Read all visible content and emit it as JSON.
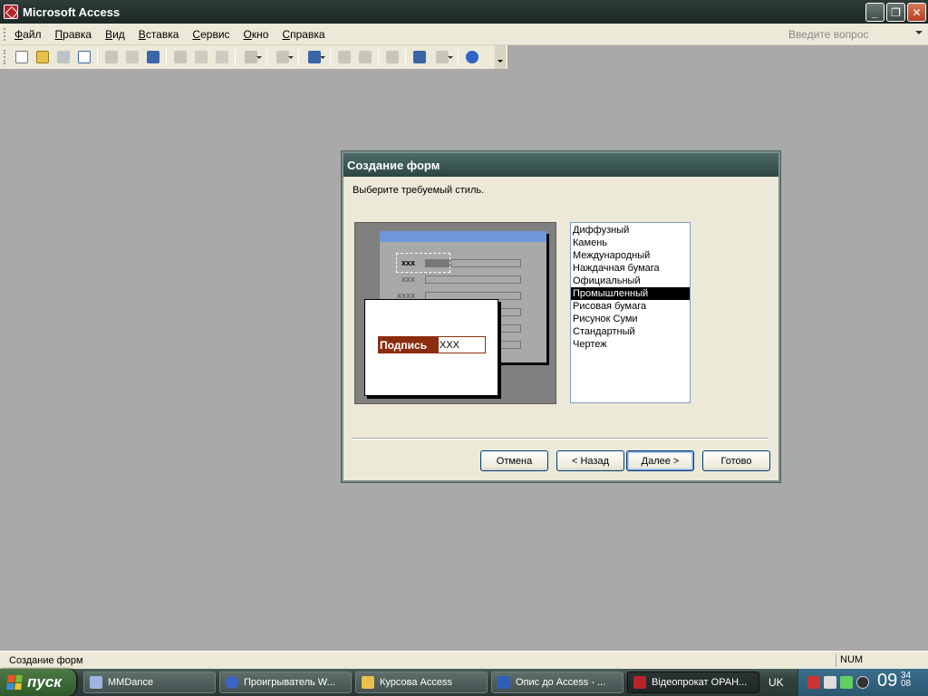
{
  "window": {
    "title": "Microsoft Access"
  },
  "window_buttons": {
    "minimize": "_",
    "restore": "❐",
    "close": "✕"
  },
  "menu": {
    "items": [
      "Файл",
      "Правка",
      "Вид",
      "Вставка",
      "Сервис",
      "Окно",
      "Справка"
    ],
    "ask_placeholder": "Введите вопрос"
  },
  "dialog": {
    "title": "Создание форм",
    "prompt": "Выберите требуемый стиль.",
    "preview": {
      "rows": [
        "xxx",
        "xxx",
        "xxxx"
      ],
      "caption": "Подпись",
      "value": "XXX"
    },
    "styles": [
      "Диффузный",
      "Камень",
      "Международный",
      "Наждачная бумага",
      "Официальный",
      "Промышленный",
      "Рисовая бумага",
      "Рисунок Суми",
      "Стандартный",
      "Чертеж"
    ],
    "selected_style": "Промышленный",
    "buttons": {
      "cancel": "Отмена",
      "back": "< Назад",
      "next": "Далее >",
      "finish": "Готово"
    }
  },
  "statusbar": {
    "text": "Создание форм",
    "num": "NUM"
  },
  "taskbar": {
    "start": "пуск",
    "tasks": [
      "MMDance",
      "Проигрыватель W...",
      "Курсова Access",
      "Опис до Access - ...",
      "Відеопрокат ОРАН..."
    ],
    "lang": "UK",
    "clock_hm": "09",
    "clock_min": "34",
    "clock_sec": "08"
  }
}
